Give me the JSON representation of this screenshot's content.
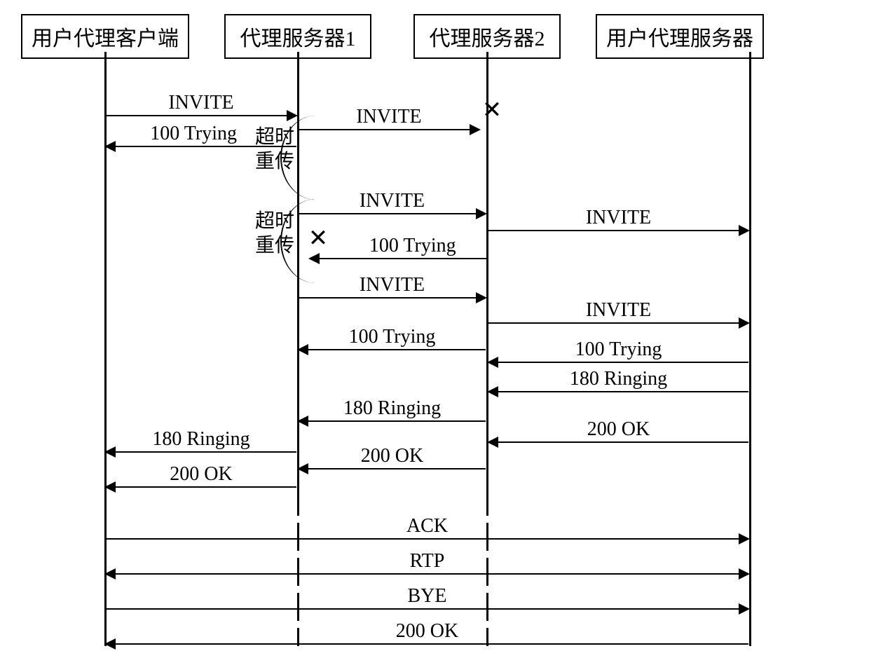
{
  "participants": {
    "uac": "用户代理客户端",
    "proxy1": "代理服务器1",
    "proxy2": "代理服务器2",
    "uas": "用户代理服务器"
  },
  "messages": {
    "invite": "INVITE",
    "trying": "100 Trying",
    "ringing": "180 Ringing",
    "ok": "200 OK",
    "ack": "ACK",
    "rtp": "RTP",
    "bye": "BYE"
  },
  "annotations": {
    "timeout_retry": "超时\n重传"
  }
}
